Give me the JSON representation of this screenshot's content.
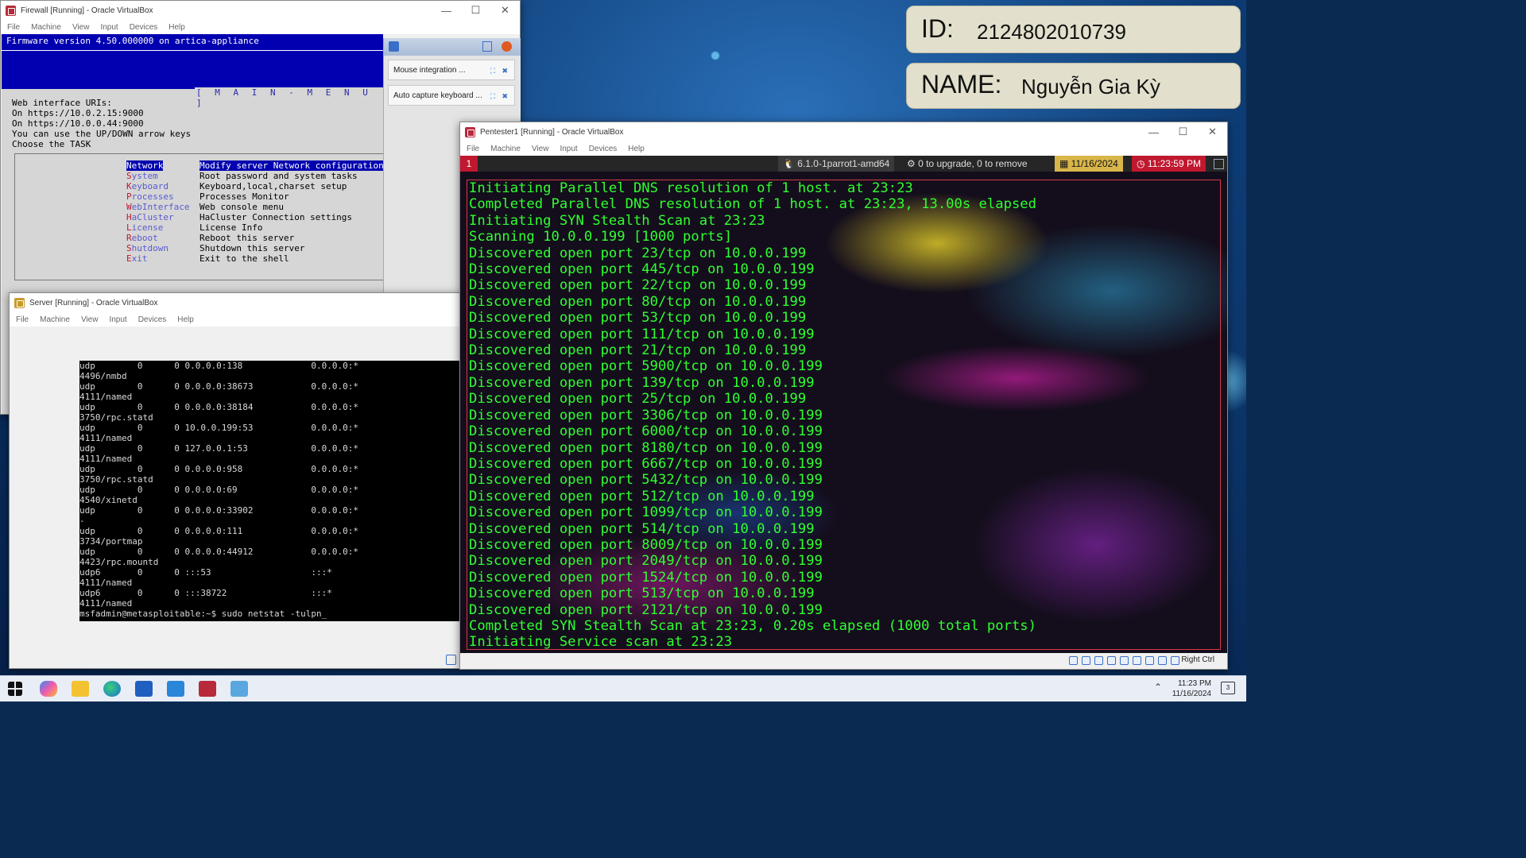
{
  "identity": {
    "id_label": "ID:",
    "id_value": "2124802010739",
    "name_label": "NAME:",
    "name_value": "Nguyễn Gia Kỳ"
  },
  "menu_labels": [
    "File",
    "Machine",
    "View",
    "Input",
    "Devices",
    "Help"
  ],
  "firewall": {
    "title": "Firewall [Running] - Oracle VirtualBox",
    "firmware_line": "Firmware version 4.50.000000 on artica-appliance",
    "main_menu_title": "[ M A I N - M E N U ]",
    "info_lines": [
      "Web interface URIs:",
      "On https://10.0.2.15:9000",
      "On https://10.0.0.44:9000",
      "You can use the UP/DOWN arrow keys",
      "Choose the TASK"
    ],
    "menu": [
      {
        "hot": "N",
        "rest": "etwork",
        "desc": "Modify server Network configuration"
      },
      {
        "hot": "S",
        "rest": "ystem",
        "desc": "Root password and system tasks"
      },
      {
        "hot": "K",
        "rest": "eyboard",
        "desc": "Keyboard,local,charset setup"
      },
      {
        "hot": "P",
        "rest": "rocesses",
        "desc": "Processes Monitor"
      },
      {
        "hot": "W",
        "rest": "ebInterface",
        "desc": "Web console menu"
      },
      {
        "hot": "H",
        "rest": "aCluster",
        "desc": "HaCluster Connection settings"
      },
      {
        "hot": "L",
        "rest": "icense",
        "desc": "License Info"
      },
      {
        "hot": "R",
        "rest": "eboot",
        "desc": "Reboot this server"
      },
      {
        "hot": "S",
        "rest": "hutdown",
        "desc": "Shutdown this server"
      },
      {
        "hot": "E",
        "rest": "xit",
        "desc": "Exit to the shell"
      }
    ],
    "notifications": [
      "Mouse integration ...",
      "Auto capture keyboard ..."
    ]
  },
  "server": {
    "title": "Server [Running] - Oracle VirtualBox",
    "lines": [
      "udp        0      0 0.0.0.0:138             0.0.0.0:*",
      "4496/nmbd",
      "udp        0      0 0.0.0.0:38673           0.0.0.0:*",
      "4111/named",
      "udp        0      0 0.0.0.0:38184           0.0.0.0:*",
      "3750/rpc.statd",
      "udp        0      0 10.0.0.199:53           0.0.0.0:*",
      "4111/named",
      "udp        0      0 127.0.0.1:53            0.0.0.0:*",
      "4111/named",
      "udp        0      0 0.0.0.0:958             0.0.0.0:*",
      "3750/rpc.statd",
      "udp        0      0 0.0.0.0:69              0.0.0.0:*",
      "4540/xinetd",
      "udp        0      0 0.0.0.0:33902           0.0.0.0:*",
      "-",
      "udp        0      0 0.0.0.0:111             0.0.0.0:*",
      "3734/portmap",
      "udp        0      0 0.0.0.0:44912           0.0.0.0:*",
      "4423/rpc.mountd",
      "udp6       0      0 :::53                   :::*",
      "4111/named",
      "udp6       0      0 :::38722                :::*",
      "4111/named",
      "msfadmin@metasploitable:~$ sudo netstat -tulpn_"
    ]
  },
  "pentester": {
    "title": "Pentester1 [Running] - Oracle VirtualBox",
    "workspace": "1",
    "kernel": "6.1.0-1parrot1-amd64",
    "updates": "0 to upgrade, 0 to remove",
    "date": "11/16/2024",
    "time": "11:23:59 PM",
    "host_key": "Right Ctrl",
    "lines": [
      "Initiating Parallel DNS resolution of 1 host. at 23:23",
      "Completed Parallel DNS resolution of 1 host. at 23:23, 13.00s elapsed",
      "Initiating SYN Stealth Scan at 23:23",
      "Scanning 10.0.0.199 [1000 ports]",
      "Discovered open port 23/tcp on 10.0.0.199",
      "Discovered open port 445/tcp on 10.0.0.199",
      "Discovered open port 22/tcp on 10.0.0.199",
      "Discovered open port 80/tcp on 10.0.0.199",
      "Discovered open port 53/tcp on 10.0.0.199",
      "Discovered open port 111/tcp on 10.0.0.199",
      "Discovered open port 21/tcp on 10.0.0.199",
      "Discovered open port 5900/tcp on 10.0.0.199",
      "Discovered open port 139/tcp on 10.0.0.199",
      "Discovered open port 25/tcp on 10.0.0.199",
      "Discovered open port 3306/tcp on 10.0.0.199",
      "Discovered open port 6000/tcp on 10.0.0.199",
      "Discovered open port 8180/tcp on 10.0.0.199",
      "Discovered open port 6667/tcp on 10.0.0.199",
      "Discovered open port 5432/tcp on 10.0.0.199",
      "Discovered open port 512/tcp on 10.0.0.199",
      "Discovered open port 1099/tcp on 10.0.0.199",
      "Discovered open port 514/tcp on 10.0.0.199",
      "Discovered open port 8009/tcp on 10.0.0.199",
      "Discovered open port 2049/tcp on 10.0.0.199",
      "Discovered open port 1524/tcp on 10.0.0.199",
      "Discovered open port 513/tcp on 10.0.0.199",
      "Discovered open port 2121/tcp on 10.0.0.199",
      "Completed SYN Stealth Scan at 23:23, 0.20s elapsed (1000 total ports)",
      "Initiating Service scan at 23:23"
    ]
  },
  "taskbar": {
    "apps": [
      "start-button",
      "copilot",
      "file-explorer",
      "edge",
      "word",
      "visual-studio-code",
      "virtualbox",
      "pinned-app"
    ],
    "time": "11:23 PM",
    "date": "11/16/2024",
    "notification_count": "3"
  },
  "colors": {
    "terminal_green": "#30ff30",
    "firewall_blue": "#0000b0",
    "parrot_red": "#c0182e",
    "date_yellow": "#d9b64a"
  }
}
